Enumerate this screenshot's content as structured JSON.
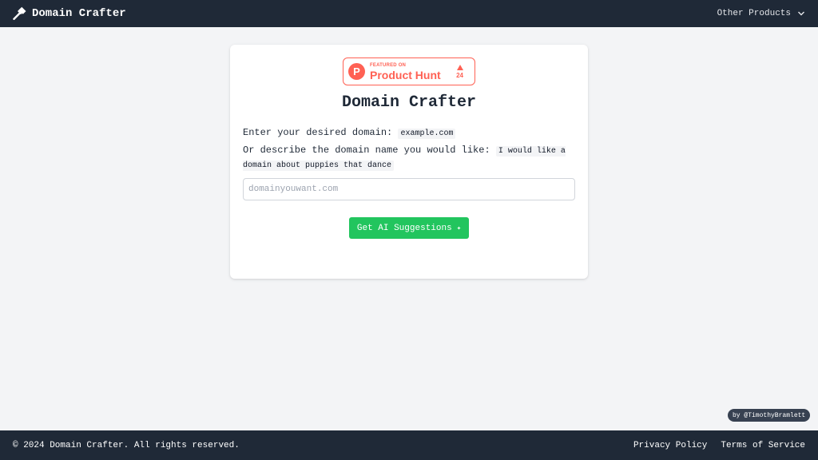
{
  "header": {
    "title": "Domain Crafter",
    "other_products_label": "Other Products"
  },
  "badge": {
    "featured_text": "FEATURED ON",
    "name": "Product Hunt",
    "votes": "24",
    "logo_letter": "P",
    "accent": "#ff6154"
  },
  "card": {
    "title": "Domain Crafter",
    "line1_text": "Enter your desired domain: ",
    "line1_example": "example.com",
    "line2_text": "Or describe the domain name you would like: ",
    "line2_example": "I would like a domain about puppies that dance",
    "input_value": "",
    "input_placeholder": "domainyouwant.com",
    "button_label": "Get AI Suggestions",
    "button_icon": "sparkle-icon"
  },
  "author": {
    "label": "by @TimothyBramlett"
  },
  "footer": {
    "copyright": "© 2024 Domain Crafter. All rights reserved.",
    "links": [
      "Privacy Policy",
      "Terms of Service"
    ]
  },
  "colors": {
    "nav_bg": "#1f2937",
    "page_bg": "#f3f4f6",
    "button_bg": "#22c55e",
    "product_hunt": "#ff6154"
  }
}
